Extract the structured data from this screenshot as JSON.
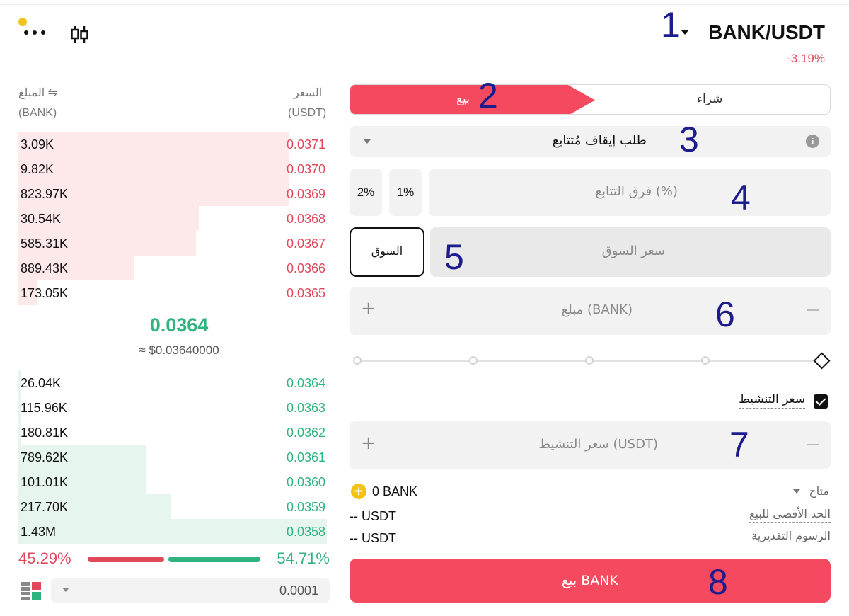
{
  "header": {
    "pair": "BANK/USDT",
    "change": "-3.19%"
  },
  "orderbook": {
    "amount_label": "المبلغ ⇋",
    "price_label": "السعر",
    "amount_unit": "(BANK)",
    "price_unit": "(USDT)",
    "asks": [
      {
        "amount": "3.09K",
        "price": "0.0371",
        "depth": 0.87
      },
      {
        "amount": "9.82K",
        "price": "0.0370",
        "depth": 0.87
      },
      {
        "amount": "823.97K",
        "price": "0.0369",
        "depth": 0.87
      },
      {
        "amount": "30.54K",
        "price": "0.0368",
        "depth": 0.58
      },
      {
        "amount": "585.31K",
        "price": "0.0367",
        "depth": 0.57
      },
      {
        "amount": "889.43K",
        "price": "0.0366",
        "depth": 0.37
      },
      {
        "amount": "173.05K",
        "price": "0.0365",
        "depth": 0.06
      }
    ],
    "mid_price": "0.0364",
    "mid_usd": "≈ $0.03640000",
    "bids": [
      {
        "amount": "26.04K",
        "price": "0.0364",
        "depth": 0.0
      },
      {
        "amount": "115.96K",
        "price": "0.0363",
        "depth": 0.0
      },
      {
        "amount": "180.81K",
        "price": "0.0362",
        "depth": 0.0
      },
      {
        "amount": "789.62K",
        "price": "0.0361",
        "depth": 0.41
      },
      {
        "amount": "101.01K",
        "price": "0.0360",
        "depth": 0.41
      },
      {
        "amount": "217.70K",
        "price": "0.0359",
        "depth": 0.49
      },
      {
        "amount": "1.43M",
        "price": "0.0358",
        "depth": 0.99
      }
    ],
    "sell_ratio": "45.29%",
    "buy_ratio": "54.71%",
    "tick_size": "0.0001"
  },
  "trade": {
    "buy_tab": "شراء",
    "sell_tab": "بيع",
    "order_type": "طلب إيقاف مُتتابع",
    "trail_placeholder": "فرق التتابع (%)",
    "pct_options": [
      "2%",
      "1%"
    ],
    "market_button": "السوق",
    "market_placeholder": "سعر السوق",
    "amount_placeholder": "مبلغ (BANK)",
    "trigger_checkbox_label": "سعر التنشيط",
    "trigger_placeholder": "سعر التنشيط (USDT)",
    "available_label": "متاح",
    "available_value": "0 BANK",
    "max_sell_label": "الحد الأقصى للبيع",
    "max_sell_value": "-- USDT",
    "fee_label": "الرسوم التقديرية",
    "fee_value": "-- USDT",
    "submit_label": "بيع BANK"
  },
  "annotations": [
    "1",
    "2",
    "3",
    "4",
    "5",
    "6",
    "7",
    "8"
  ],
  "colors": {
    "sell": "#f4495e",
    "buy": "#2fb37f",
    "annotation": "#1c1c8c",
    "notification": "#f0c419"
  }
}
